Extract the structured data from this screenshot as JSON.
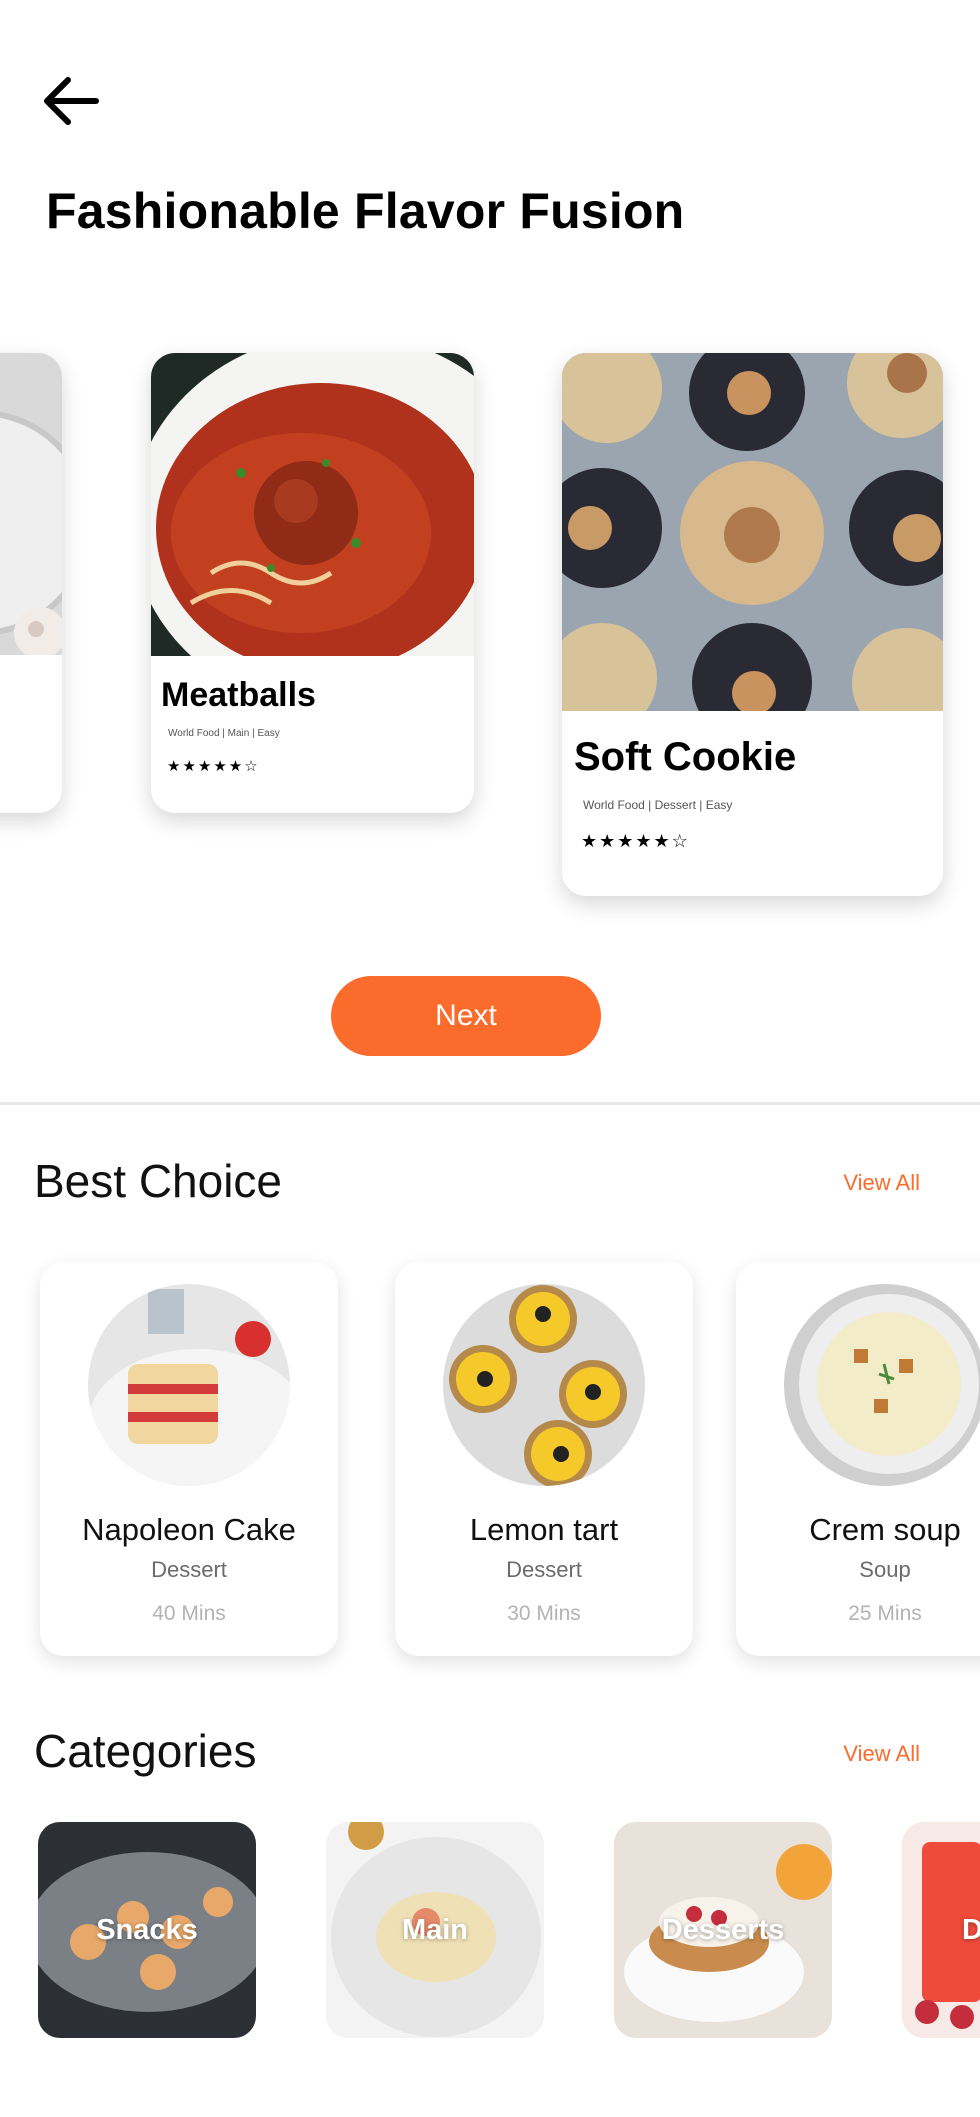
{
  "header": {
    "back_icon": "arrow-left-icon",
    "title": "Fashionable Flavor Fusion"
  },
  "carousel": {
    "cards": [
      {
        "name": "",
        "meta": "",
        "rating": 0
      },
      {
        "name": "Meatballs",
        "meta": "World Food | Main | Easy",
        "stars": "★★★★★☆",
        "rating": 4.5
      },
      {
        "name": "Soft Cookie",
        "meta": "World Food | Dessert | Easy",
        "stars": "★★★★★☆",
        "rating": 4.5
      }
    ]
  },
  "next_button": {
    "label": "Next"
  },
  "best_choice": {
    "title": "Best Choice",
    "view_all": "View All",
    "items": [
      {
        "name": "Napoleon Cake",
        "type": "Dessert",
        "time": "40 Mins"
      },
      {
        "name": "Lemon tart",
        "type": "Dessert",
        "time": "30 Mins"
      },
      {
        "name": "Crem soup",
        "type": "Soup",
        "time": "25 Mins"
      }
    ]
  },
  "categories": {
    "title": "Categories",
    "view_all": "View All",
    "items": [
      {
        "label": "Snacks"
      },
      {
        "label": "Main"
      },
      {
        "label": "Desserts"
      },
      {
        "label": "D"
      }
    ]
  },
  "colors": {
    "accent": "#FB6B2C",
    "background": "#FFFFFF",
    "text": "#000000"
  }
}
